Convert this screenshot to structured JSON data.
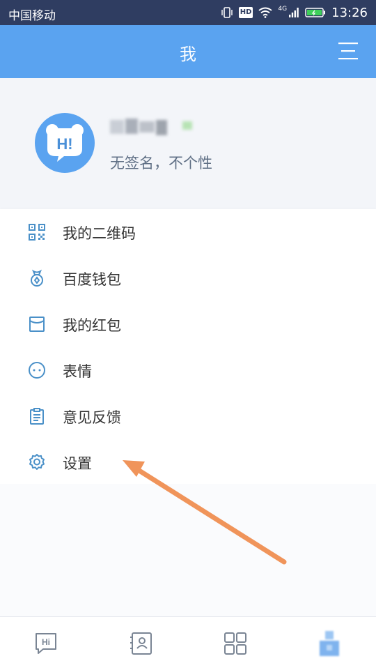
{
  "status_bar": {
    "carrier": "中国移动",
    "hd_badge": "HD",
    "network": "4G",
    "time": "13:26"
  },
  "header": {
    "title": "我"
  },
  "profile": {
    "signature": "无签名，不个性",
    "avatar_text": "H!"
  },
  "menu": {
    "items": [
      {
        "label": "我的二维码",
        "icon": "qr-code-icon"
      },
      {
        "label": "百度钱包",
        "icon": "wallet-icon"
      },
      {
        "label": "我的红包",
        "icon": "red-envelope-icon"
      },
      {
        "label": "表情",
        "icon": "emoji-icon"
      },
      {
        "label": "意见反馈",
        "icon": "feedback-clipboard-icon"
      },
      {
        "label": "设置",
        "icon": "gear-icon"
      }
    ]
  },
  "bottom_nav": {
    "tabs": [
      {
        "icon": "chat-icon",
        "text": "Hi"
      },
      {
        "icon": "contacts-icon"
      },
      {
        "icon": "apps-grid-icon"
      },
      {
        "icon": "me-icon"
      }
    ]
  },
  "colors": {
    "accent": "#5aa3f0",
    "status_bar": "#2f3d61",
    "icon": "#4a90c8",
    "arrow": "#f0945a"
  }
}
